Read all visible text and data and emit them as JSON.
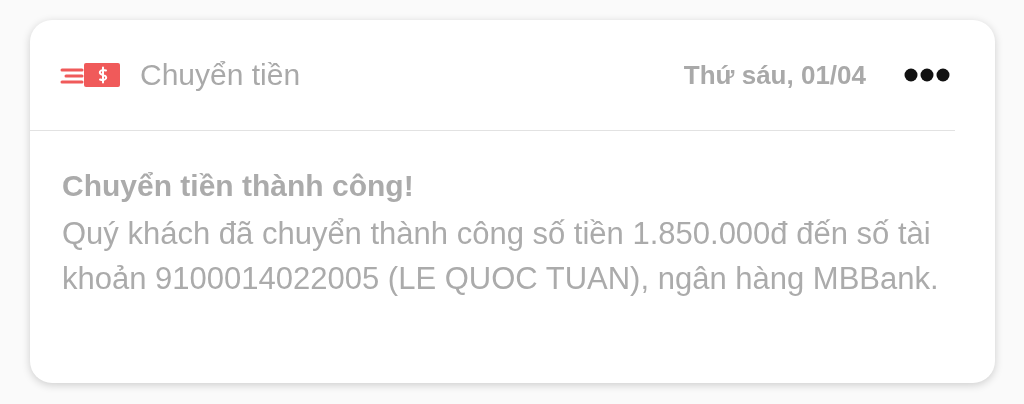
{
  "notification": {
    "app_name": "Chuyển tiền",
    "date": "Thứ sáu, 01/04",
    "title": "Chuyển tiền thành công!",
    "message": "Quý khách đã chuyển thành công số tiền 1.850.000đ đến số tài khoản 9100014022005 (LE QUOC TUAN), ngân hàng MBBank."
  }
}
